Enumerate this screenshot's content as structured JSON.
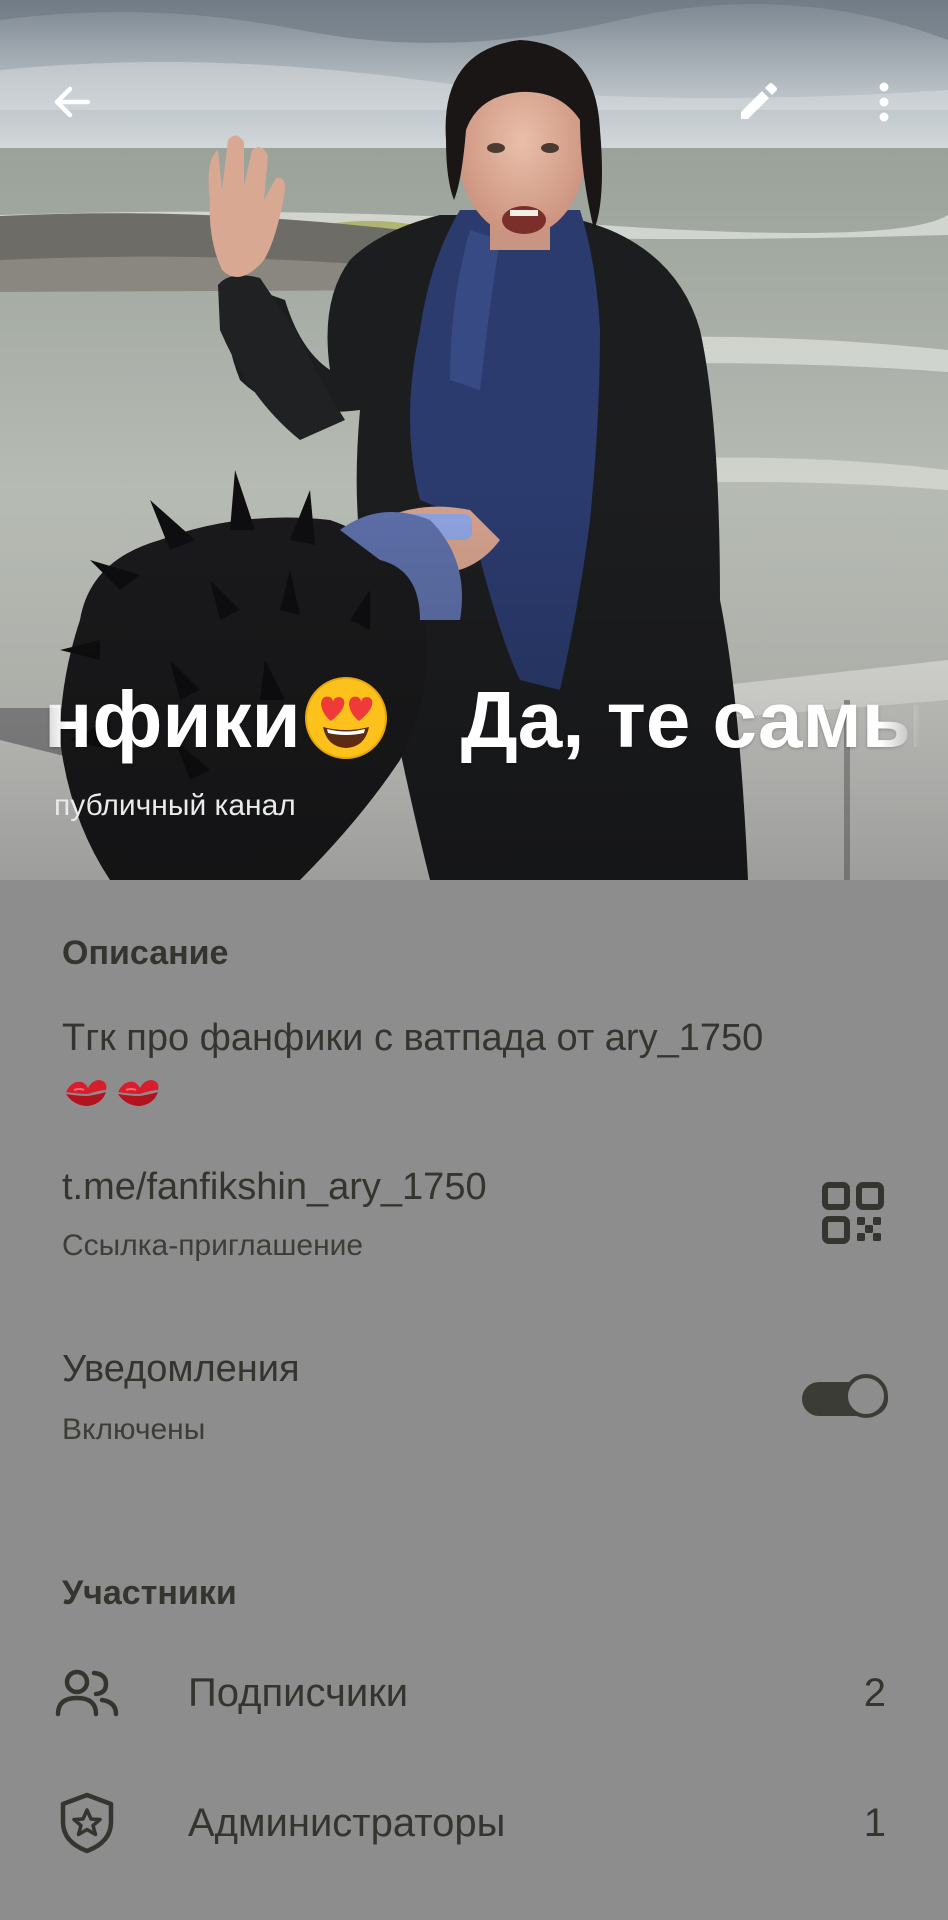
{
  "header": {
    "title_part1": "нфики",
    "title_part2": "Да, те самы",
    "subtitle": "публичный канал"
  },
  "icons": {
    "back": "arrow-left-icon",
    "edit": "pencil-icon",
    "more": "more-vertical-icon",
    "title_emoji": "heart-eyes-emoji-icon",
    "kiss": "kiss-mark-emoji-icon",
    "qr": "qr-code-icon",
    "subscribers": "people-icon",
    "admins": "shield-star-icon"
  },
  "info": {
    "description_label": "Описание",
    "description_text": "Тгк про фанфики с ватпада от ary_1750",
    "link": "t.me/fanfikshin_ary_1750",
    "link_caption": "Ссылка-приглашение",
    "notifications_label": "Уведомления",
    "notifications_status": "Включены",
    "notifications_enabled": true
  },
  "members": {
    "section_label": "Участники",
    "subscribers_label": "Подписчики",
    "subscribers_count": "2",
    "admins_label": "Администраторы",
    "admins_count": "1"
  },
  "colors": {
    "panel_background": "#8d8d8d",
    "text": "#34352f",
    "title": "#ffffff"
  }
}
